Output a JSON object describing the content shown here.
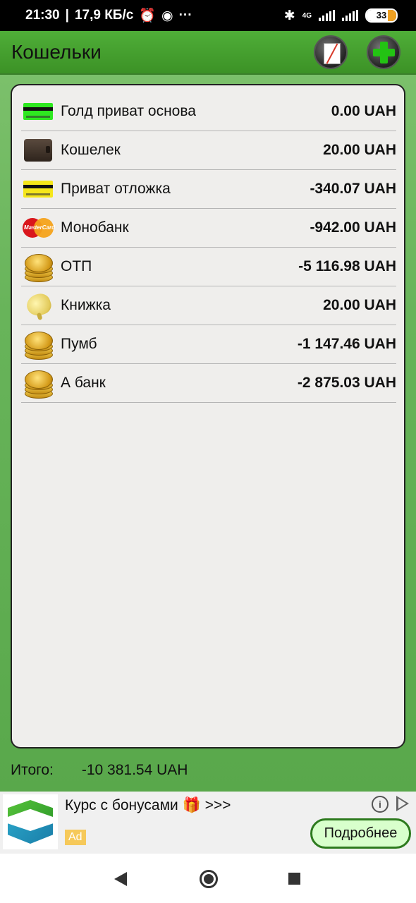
{
  "status_bar": {
    "time": "21:30",
    "speed": "17,9 КБ/с",
    "battery": "33",
    "network": "4G",
    "icons": [
      "alarm-icon",
      "media-icon",
      "more-icon",
      "bluetooth-icon",
      "signal-icon",
      "battery-icon"
    ]
  },
  "toolbar": {
    "title": "Кошельки",
    "edit_icon": "notepad-edit-icon",
    "add_icon": "plus-icon"
  },
  "wallets": [
    {
      "name": "Голд приват основа",
      "amount": "0.00 UAH",
      "icon": "green-card-icon"
    },
    {
      "name": "Кошелек",
      "amount": "20.00 UAH",
      "icon": "wallet-icon"
    },
    {
      "name": "Приват отложка",
      "amount": "-340.07 UAH",
      "icon": "yellow-card-icon"
    },
    {
      "name": "Монобанк",
      "amount": "-942.00 UAH",
      "icon": "mastercard-icon"
    },
    {
      "name": "ОТП",
      "amount": "-5 116.98 UAH",
      "icon": "coins-icon"
    },
    {
      "name": "Книжка",
      "amount": "20.00 UAH",
      "icon": "piggy-bank-icon"
    },
    {
      "name": "Пумб",
      "amount": "-1 147.46 UAH",
      "icon": "coins-icon"
    },
    {
      "name": "А банк",
      "amount": "-2 875.03 UAH",
      "icon": "coins-icon"
    }
  ],
  "total": {
    "label": "Итого:",
    "value": "-10 381.54 UAH"
  },
  "ad": {
    "title": "Курс с бонусами 🎁 >>>",
    "badge": "Ad",
    "button": "Подробнее",
    "info": "i"
  },
  "colors": {
    "toolbar": "#45a030",
    "background": "#68b45a",
    "panel": "#efeeec",
    "ad_button_border": "#2d7a1e"
  }
}
